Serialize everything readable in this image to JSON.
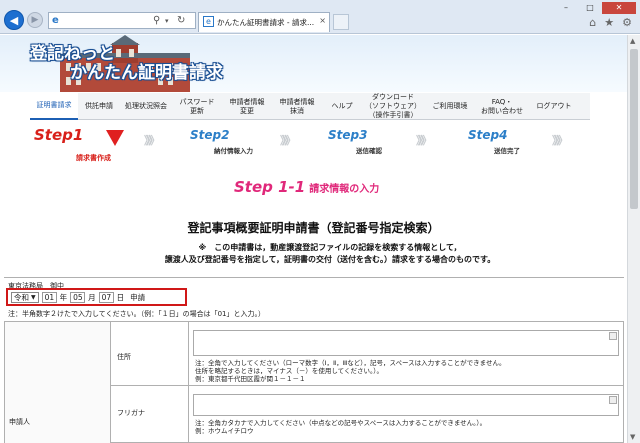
{
  "browser": {
    "tab_title": "かんたん証明書請求 - 請求...",
    "tab_close": "×",
    "address_icons": {
      "ie": "e",
      "search": "⚲",
      "dropdown": "▾",
      "refresh": "↻"
    },
    "window_controls": {
      "minimize": "–",
      "maximize": "□",
      "close": "✕"
    },
    "tool_icons": {
      "home": "⌂",
      "favorites": "★",
      "settings": "⚙"
    },
    "back": "◀",
    "forward": "▶"
  },
  "site": {
    "title_line1": "登記ねっと",
    "title_line2": "かんたん証明書請求"
  },
  "nav": {
    "items": [
      {
        "label": "証明書請求",
        "active": true
      },
      {
        "label": "供託申請"
      },
      {
        "label": "処理状況照会"
      },
      {
        "label": "パスワード\n更新"
      },
      {
        "label": "申請者情報\n変更"
      },
      {
        "label": "申請者情報\n抹消"
      },
      {
        "label": "ヘルプ"
      },
      {
        "label": "ダウンロード\n（ソフトウェア）\n（操作手引書）"
      },
      {
        "label": "ご利用環境"
      },
      {
        "label": "FAQ・\nお問い合わせ"
      },
      {
        "label": "ログアウト"
      }
    ]
  },
  "steps": {
    "step1": "Step1",
    "step1_sub": "請求書作成",
    "step2": "Step2",
    "step2_sub": "納付情報入力",
    "step3": "Step3",
    "step3_sub": "送信確認",
    "step4": "Step4",
    "step4_sub": "送信完了",
    "chevrons": "》》》"
  },
  "section": {
    "step_label": "Step 1-1",
    "step_sub": "請求情報の入力",
    "doc_title": "登記事項概要証明申請書（登記番号指定検索）",
    "notice_line1": "※　この申請書は，動産譲渡登記ファイルの記録を検索する情報として，",
    "notice_line2": "譲渡人及び登記番号を指定して，証明書の交付（送付を含む。）請求をする場合のものです。"
  },
  "form": {
    "addressee": "東京法務局　御中",
    "era": "令和",
    "year": "01",
    "year_unit": "年",
    "month": "05",
    "month_unit": "月",
    "day": "07",
    "day_unit": "日",
    "apply": "申請",
    "date_note": "注：半角数字２けたで入力してください。（例：「１日」の場合は「01」と入力。）"
  },
  "table": {
    "applicant_label": "申請人",
    "address_label": "住所",
    "address_note1": "注：全角で入力してください（ローマ数字（Ⅰ，Ⅱ，Ⅲなど），記号，スペースは入力することができません。",
    "address_note2": "住所を略記するときは，マイナス（－）を使用してください。）。",
    "address_note3": "例：東京都千代田区霞が関１－１－１",
    "kana_label": "フリガナ",
    "kana_note1": "注：全角カタカナで入力してください（中点などの記号やスペースは入力することができません。）。",
    "kana_note2": "例：ホウムイチロウ"
  },
  "colors": {
    "accent_blue": "#1c5fb4",
    "step_red": "#d8201a",
    "step_blue": "#2c7fc8",
    "section_pink": "#e0287a",
    "highlight_red": "#d01818"
  }
}
